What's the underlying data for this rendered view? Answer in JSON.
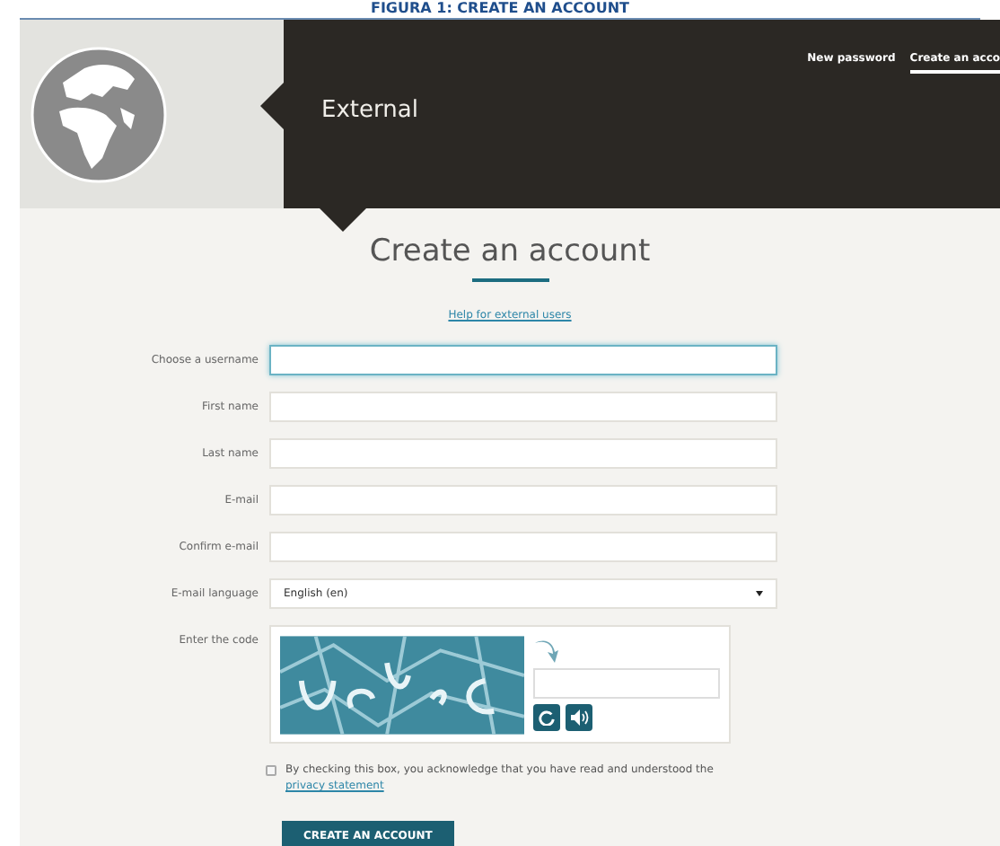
{
  "caption": "FIGURA 1: CREATE AN ACCOUNT",
  "header": {
    "section_title": "External",
    "nav": [
      {
        "label": "New password",
        "selected": false
      },
      {
        "label": "Create an acco",
        "selected": true
      }
    ]
  },
  "form": {
    "title": "Create an account",
    "help_link": "Help for external users",
    "fields": [
      {
        "kind": "text",
        "label": "Choose a username",
        "focused": true
      },
      {
        "kind": "text",
        "label": "First name",
        "focused": false
      },
      {
        "kind": "text",
        "label": "Last name",
        "focused": false
      },
      {
        "kind": "text",
        "label": "E-mail",
        "focused": false
      },
      {
        "kind": "text",
        "label": "Confirm e-mail",
        "focused": false
      },
      {
        "kind": "select",
        "label": "E-mail language",
        "value": "English (en)",
        "focused": false
      },
      {
        "kind": "captcha",
        "label": "Enter the code",
        "focused": false
      }
    ],
    "consent": {
      "checked": false,
      "text": "By checking this box, you acknowledge that you have read and understood the",
      "link": "privacy statement"
    },
    "submit": "CREATE AN ACCOUNT"
  }
}
